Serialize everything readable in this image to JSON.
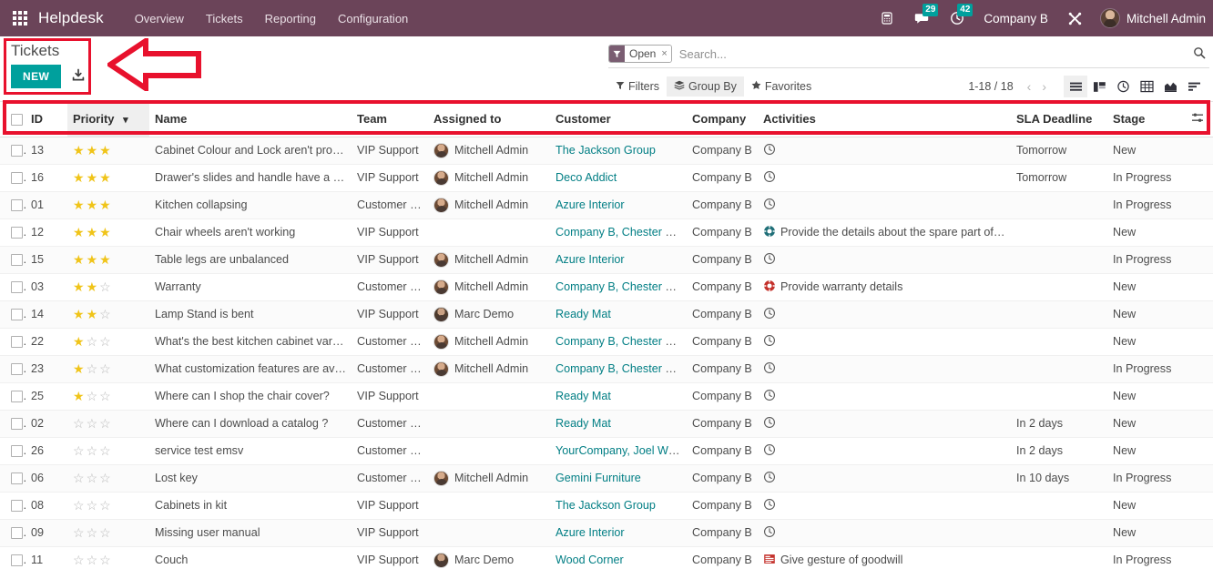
{
  "navbar": {
    "apps_icon": "apps-grid-icon",
    "brand": "Helpdesk",
    "menu": [
      {
        "label": "Overview"
      },
      {
        "label": "Tickets"
      },
      {
        "label": "Reporting"
      },
      {
        "label": "Configuration"
      }
    ],
    "icons": [
      {
        "name": "phone-icon",
        "glyph": "☎",
        "badge": null
      },
      {
        "name": "messages-icon",
        "glyph": "💬",
        "badge": "29"
      },
      {
        "name": "activities-clock-icon",
        "glyph": "◴",
        "badge": "42"
      }
    ],
    "company": "Company B",
    "debug_icon": "tools-icon",
    "user_name": "Mitchell Admin",
    "avatar": "user-avatar"
  },
  "control_panel": {
    "title": "Tickets",
    "new_label": "NEW",
    "import_icon": "import-download-icon",
    "search": {
      "facet_icon": "filter-funnel-icon",
      "facet_label": "Open",
      "facet_remove": "×",
      "placeholder": "Search...",
      "value": "",
      "magnifier_icon": "search-icon"
    },
    "filters_label": "Filters",
    "groupby_label": "Group By",
    "favorites_label": "Favorites",
    "pager": "1-18 / 18",
    "prev_icon": "chevron-left-icon",
    "next_icon": "chevron-right-icon",
    "views": [
      {
        "name": "list-view",
        "icon": "list-icon",
        "active": true
      },
      {
        "name": "kanban-view",
        "icon": "kanban-icon",
        "active": false
      },
      {
        "name": "activity-view",
        "icon": "clock-icon",
        "active": false
      },
      {
        "name": "pivot-view",
        "icon": "pivot-grid-icon",
        "active": false
      },
      {
        "name": "graph-view",
        "icon": "area-chart-icon",
        "active": false
      },
      {
        "name": "cohort-view",
        "icon": "bars-icon",
        "active": false
      }
    ]
  },
  "table": {
    "columns": [
      {
        "key": "select",
        "label": ""
      },
      {
        "key": "id",
        "label": "ID"
      },
      {
        "key": "priority",
        "label": "Priority",
        "sorted": true,
        "sort_icon": "chevron-down-icon"
      },
      {
        "key": "name",
        "label": "Name"
      },
      {
        "key": "team",
        "label": "Team"
      },
      {
        "key": "assigned",
        "label": "Assigned to"
      },
      {
        "key": "customer",
        "label": "Customer"
      },
      {
        "key": "company",
        "label": "Company"
      },
      {
        "key": "activities",
        "label": "Activities"
      },
      {
        "key": "sla",
        "label": "SLA Deadline"
      },
      {
        "key": "stage",
        "label": "Stage"
      },
      {
        "key": "options",
        "label": "",
        "icon": "column-options-icon"
      }
    ],
    "rows": [
      {
        "id": "13",
        "priority": 3,
        "name": "Cabinet Colour and Lock aren't proper",
        "team": "VIP Support",
        "assigned": "Mitchell Admin",
        "avatar": "mitchell",
        "customer": "The Jackson Group",
        "company": "Company B",
        "activity_icon": "clock",
        "activity": "",
        "sla": "Tomorrow",
        "stage": "New"
      },
      {
        "id": "16",
        "priority": 3,
        "name": "Drawer's slides and handle have a defect",
        "team": "VIP Support",
        "assigned": "Mitchell Admin",
        "avatar": "mitchell",
        "customer": "Deco Addict",
        "company": "Company B",
        "activity_icon": "clock",
        "activity": "",
        "sla": "Tomorrow",
        "stage": "In Progress"
      },
      {
        "id": "01",
        "priority": 3,
        "name": "Kitchen collapsing",
        "team": "Customer Care",
        "assigned": "Mitchell Admin",
        "avatar": "mitchell",
        "customer": "Azure Interior",
        "company": "Company B",
        "activity_icon": "clock",
        "activity": "",
        "sla": "",
        "stage": "In Progress"
      },
      {
        "id": "12",
        "priority": 3,
        "name": "Chair wheels aren't working",
        "team": "VIP Support",
        "assigned": "",
        "avatar": "",
        "customer": "Company B, Chester Reed",
        "company": "Company B",
        "activity_icon": "ring-teal",
        "activity": "Provide the details about the spare part of chair",
        "sla": "",
        "stage": "New"
      },
      {
        "id": "15",
        "priority": 3,
        "name": "Table legs are unbalanced",
        "team": "VIP Support",
        "assigned": "Mitchell Admin",
        "avatar": "mitchell",
        "customer": "Azure Interior",
        "company": "Company B",
        "activity_icon": "clock",
        "activity": "",
        "sla": "",
        "stage": "In Progress"
      },
      {
        "id": "03",
        "priority": 2,
        "name": "Warranty",
        "team": "Customer Care",
        "assigned": "Mitchell Admin",
        "avatar": "mitchell",
        "customer": "Company B, Chester Reed",
        "company": "Company B",
        "activity_icon": "ring-red",
        "activity": "Provide warranty details",
        "sla": "",
        "stage": "New"
      },
      {
        "id": "14",
        "priority": 2,
        "name": "Lamp Stand is bent",
        "team": "VIP Support",
        "assigned": "Marc Demo",
        "avatar": "marc",
        "customer": "Ready Mat",
        "company": "Company B",
        "activity_icon": "clock",
        "activity": "",
        "sla": "",
        "stage": "New"
      },
      {
        "id": "22",
        "priority": 1,
        "name": "What's the best kitchen cabinet varnish for your home?",
        "team": "Customer Care",
        "assigned": "Mitchell Admin",
        "avatar": "mitchell",
        "customer": "Company B, Chester Reed",
        "company": "Company B",
        "activity_icon": "clock",
        "activity": "",
        "sla": "",
        "stage": "New"
      },
      {
        "id": "23",
        "priority": 1,
        "name": "What customization features are available for cabinet?",
        "team": "Customer Care",
        "assigned": "Mitchell Admin",
        "avatar": "mitchell",
        "customer": "Company B, Chester Reed",
        "company": "Company B",
        "activity_icon": "clock",
        "activity": "",
        "sla": "",
        "stage": "In Progress"
      },
      {
        "id": "25",
        "priority": 1,
        "name": "Where can I shop the chair cover?",
        "team": "VIP Support",
        "assigned": "",
        "avatar": "",
        "customer": "Ready Mat",
        "company": "Company B",
        "activity_icon": "clock",
        "activity": "",
        "sla": "",
        "stage": "New"
      },
      {
        "id": "02",
        "priority": 0,
        "name": "Where can I download a catalog ?",
        "team": "Customer Care",
        "assigned": "",
        "avatar": "",
        "customer": "Ready Mat",
        "company": "Company B",
        "activity_icon": "clock",
        "activity": "",
        "sla": "In 2 days",
        "stage": "New"
      },
      {
        "id": "26",
        "priority": 0,
        "name": "service test emsv",
        "team": "Customer Care",
        "assigned": "",
        "avatar": "",
        "customer": "YourCompany, Joel Willis",
        "company": "Company B",
        "activity_icon": "clock",
        "activity": "",
        "sla": "In 2 days",
        "stage": "New"
      },
      {
        "id": "06",
        "priority": 0,
        "name": "Lost key",
        "team": "Customer Care",
        "assigned": "Mitchell Admin",
        "avatar": "mitchell",
        "customer": "Gemini Furniture",
        "company": "Company B",
        "activity_icon": "clock",
        "activity": "",
        "sla": "In 10 days",
        "stage": "In Progress"
      },
      {
        "id": "08",
        "priority": 0,
        "name": "Cabinets in kit",
        "team": "VIP Support",
        "assigned": "",
        "avatar": "",
        "customer": "The Jackson Group",
        "company": "Company B",
        "activity_icon": "clock",
        "activity": "",
        "sla": "",
        "stage": "New"
      },
      {
        "id": "09",
        "priority": 0,
        "name": "Missing user manual",
        "team": "VIP Support",
        "assigned": "",
        "avatar": "",
        "customer": "Azure Interior",
        "company": "Company B",
        "activity_icon": "clock",
        "activity": "",
        "sla": "",
        "stage": "New"
      },
      {
        "id": "11",
        "priority": 0,
        "name": "Couch",
        "team": "VIP Support",
        "assigned": "Marc Demo",
        "avatar": "marc",
        "customer": "Wood Corner",
        "company": "Company B",
        "activity_icon": "note-red",
        "activity": "Give gesture of goodwill",
        "sla": "",
        "stage": "In Progress"
      }
    ]
  },
  "annotations": {
    "accent_color": "#e8112d",
    "shapes": [
      {
        "name": "highlight-box-new-button"
      },
      {
        "name": "highlight-box-column-headers"
      },
      {
        "name": "pointer-arrow-left"
      }
    ]
  },
  "colors": {
    "navbar_bg": "#6b4459",
    "primary_button": "#00a09d",
    "link": "#017e84",
    "star_on": "#f0c419",
    "annotation_red": "#e8112d"
  }
}
